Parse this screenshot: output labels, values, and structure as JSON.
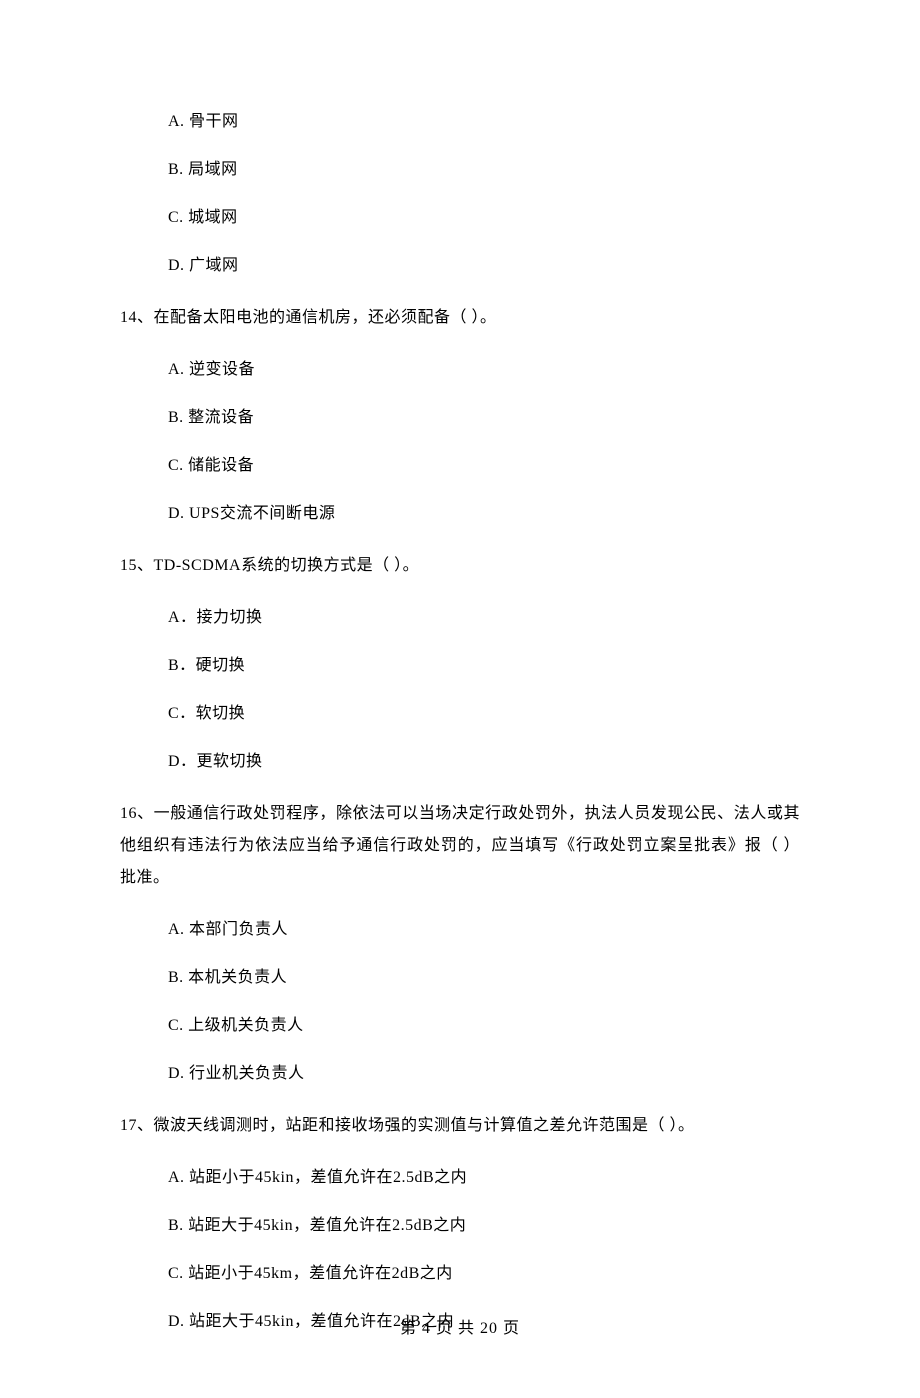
{
  "options13": {
    "a": "A.  骨干网",
    "b": "B.  局域网",
    "c": "C.  城域网",
    "d": "D.  广域网"
  },
  "q14": {
    "text": "14、在配备太阳电池的通信机房，还必须配备（    ）。",
    "a": "A.  逆变设备",
    "b": "B.  整流设备",
    "c": "C.  储能设备",
    "d": "D.  UPS交流不间断电源"
  },
  "q15": {
    "text": "15、TD-SCDMA系统的切换方式是（    ）。",
    "a": "A．接力切换",
    "b": "B．硬切换",
    "c": "C．软切换",
    "d": "D．更软切换"
  },
  "q16": {
    "text": "16、一般通信行政处罚程序，除依法可以当场决定行政处罚外，执法人员发现公民、法人或其他组织有违法行为依法应当给予通信行政处罚的，应当填写《行政处罚立案呈批表》报（    ）批准。",
    "a": "A.  本部门负责人",
    "b": "B.  本机关负责人",
    "c": "C.  上级机关负责人",
    "d": "D.  行业机关负责人"
  },
  "q17": {
    "text": "17、微波天线调测时，站距和接收场强的实测值与计算值之差允许范围是（    ）。",
    "a": "A.  站距小于45kin，差值允许在2.5dB之内",
    "b": "B.  站距大于45kin，差值允许在2.5dB之内",
    "c": "C.  站距小于45km，差值允许在2dB之内",
    "d": "D.  站距大于45kin，差值允许在2dB之内"
  },
  "footer": "第 4 页 共 20 页"
}
